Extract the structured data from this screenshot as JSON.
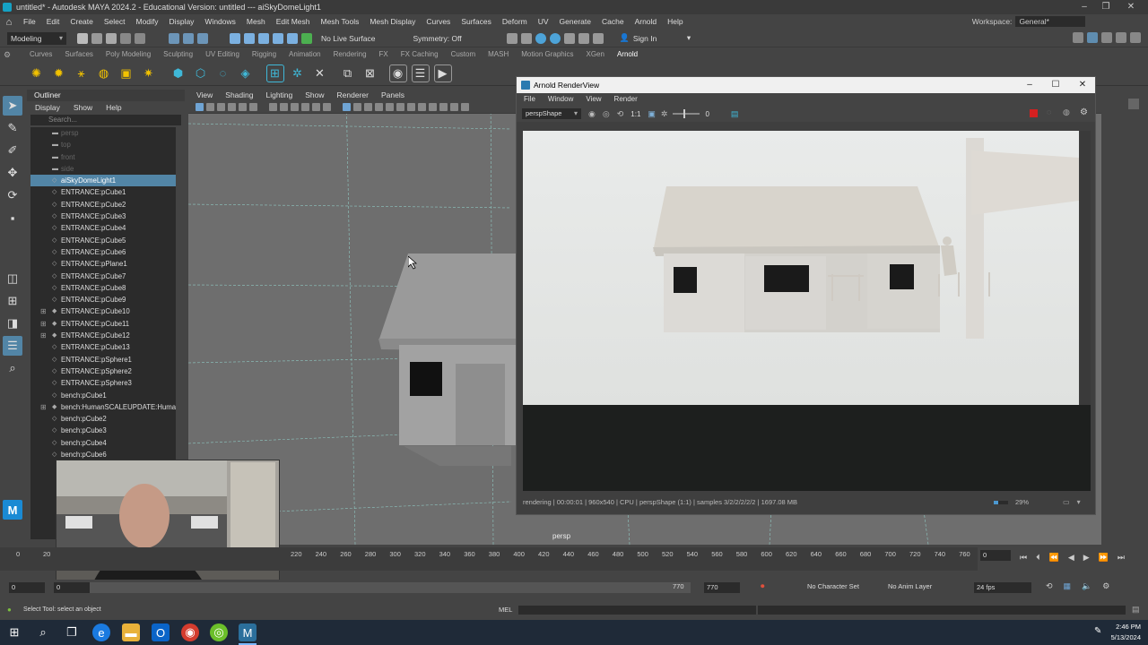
{
  "window": {
    "title": "untitled* - Autodesk MAYA 2024.2 - Educational Version: untitled   ---   aiSkyDomeLight1"
  },
  "main_menu": [
    "File",
    "Edit",
    "Create",
    "Select",
    "Modify",
    "Display",
    "Windows",
    "Mesh",
    "Edit Mesh",
    "Mesh Tools",
    "Mesh Display",
    "Curves",
    "Surfaces",
    "Deform",
    "UV",
    "Generate",
    "Cache",
    "Arnold",
    "Help"
  ],
  "workspace": {
    "label": "Workspace:",
    "value": "General*"
  },
  "status_line": {
    "menu_set": "Modeling",
    "live_surface": "No Live Surface",
    "symmetry": "Symmetry: Off",
    "sign_in": "Sign In"
  },
  "shelf_tabs": [
    "Curves",
    "Surfaces",
    "Poly Modeling",
    "Sculpting",
    "UV Editing",
    "Rigging",
    "Animation",
    "Rendering",
    "FX",
    "FX Caching",
    "Custom",
    "MASH",
    "Motion Graphics",
    "XGen",
    "Arnold"
  ],
  "shelf_active": "Arnold",
  "outliner": {
    "title": "Outliner",
    "menu": [
      "Display",
      "Show",
      "Help"
    ],
    "search_placeholder": "Search...",
    "items": [
      {
        "label": "persp",
        "dim": true
      },
      {
        "label": "top",
        "dim": true
      },
      {
        "label": "front",
        "dim": true
      },
      {
        "label": "side",
        "dim": true
      },
      {
        "label": "aiSkyDomeLight1",
        "selected": true
      },
      {
        "label": "ENTRANCE:pCube1"
      },
      {
        "label": "ENTRANCE:pCube2"
      },
      {
        "label": "ENTRANCE:pCube3"
      },
      {
        "label": "ENTRANCE:pCube4"
      },
      {
        "label": "ENTRANCE:pCube5"
      },
      {
        "label": "ENTRANCE:pCube6"
      },
      {
        "label": "ENTRANCE:pPlane1"
      },
      {
        "label": "ENTRANCE:pCube7"
      },
      {
        "label": "ENTRANCE:pCube8"
      },
      {
        "label": "ENTRANCE:pCube9"
      },
      {
        "label": "ENTRANCE:pCube10",
        "expandable": true
      },
      {
        "label": "ENTRANCE:pCube11",
        "expandable": true
      },
      {
        "label": "ENTRANCE:pCube12",
        "expandable": true
      },
      {
        "label": "ENTRANCE:pCube13"
      },
      {
        "label": "ENTRANCE:pSphere1"
      },
      {
        "label": "ENTRANCE:pSphere2"
      },
      {
        "label": "ENTRANCE:pSphere3"
      },
      {
        "label": "bench:pCube1"
      },
      {
        "label": "bench:HumanSCALEUPDATE:Humans",
        "expandable": true
      },
      {
        "label": "bench:pCube2"
      },
      {
        "label": "bench:pCube3"
      },
      {
        "label": "bench:pCube4"
      },
      {
        "label": "bench:pCube6"
      }
    ]
  },
  "viewport": {
    "menu": [
      "View",
      "Shading",
      "Lighting",
      "Show",
      "Renderer",
      "Panels"
    ],
    "camera_label": "persp"
  },
  "arnold": {
    "title": "Arnold RenderView",
    "menu": [
      "File",
      "Window",
      "View",
      "Render"
    ],
    "camera": "perspShape",
    "ratio": "1:1",
    "exposure": "0",
    "status": "rendering | 00:00:01 | 960x540 | CPU | perspShape (1:1) | samples 3/2/2/2/2/2 | 1697.08 MB",
    "progress_text": "29%",
    "progress": 0.29
  },
  "timeline": {
    "ticks": [
      "0",
      "20",
      "220",
      "240",
      "260",
      "280",
      "300",
      "320",
      "340",
      "360",
      "380",
      "400",
      "420",
      "440",
      "460",
      "480",
      "500",
      "520",
      "540",
      "560",
      "580",
      "600",
      "620",
      "640",
      "660",
      "680",
      "700",
      "720",
      "740",
      "760"
    ],
    "current_frame": "0"
  },
  "range": {
    "start": "0",
    "inner_start": "0",
    "inner_end": "770",
    "end": "770",
    "character_set": "No Character Set",
    "anim_layer": "No Anim Layer",
    "fps": "24 fps"
  },
  "command_line": {
    "lang": "MEL"
  },
  "help_line": "Select Tool: select an object",
  "clock": {
    "time": "2:46 PM",
    "date": "5/13/2024"
  },
  "colors": {
    "selection": "#5285a6",
    "maya_accent": "#15a1c4",
    "render_stop": "#d42020"
  }
}
